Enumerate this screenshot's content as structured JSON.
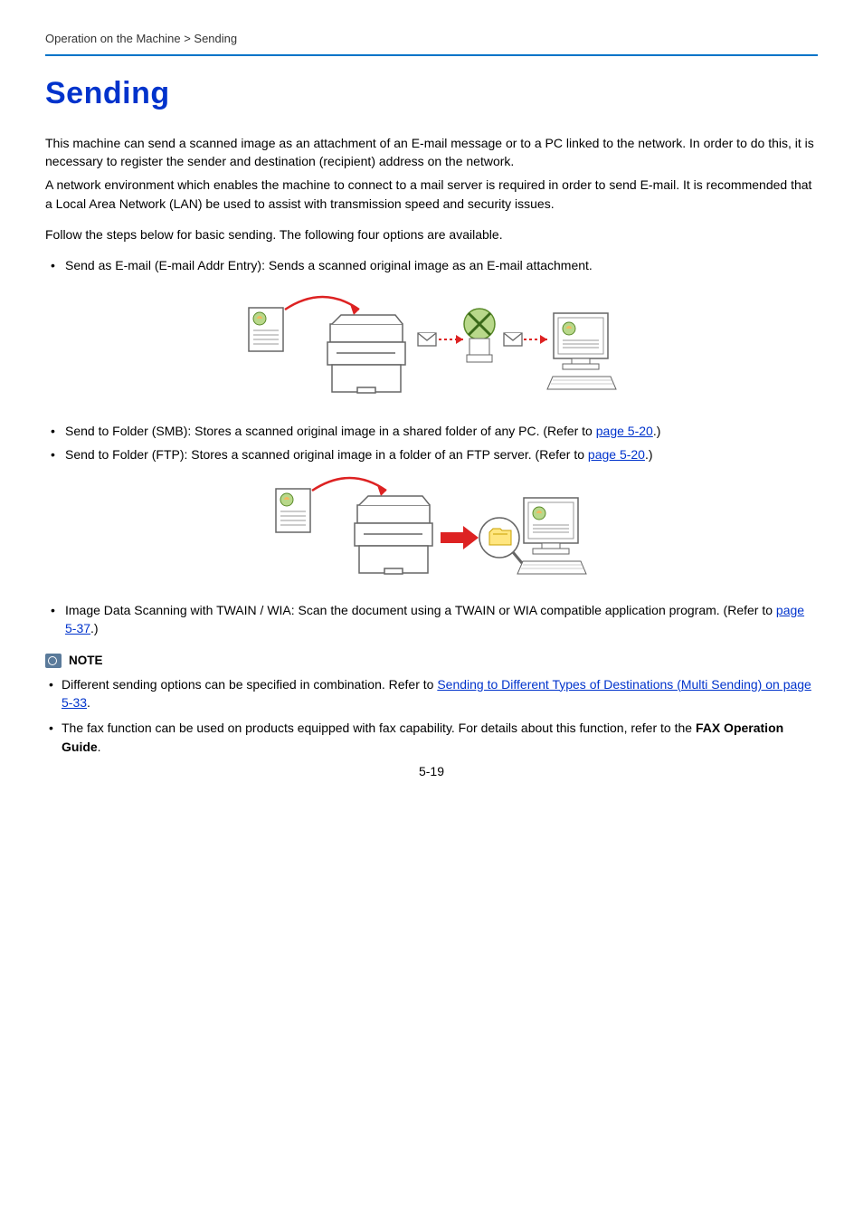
{
  "breadcrumb": "Operation on the Machine > Sending",
  "heading": "Sending",
  "intro1": "This machine can send a scanned image as an attachment of an E-mail message or to a PC linked to the network. In order to do this, it is necessary to register the sender and destination (recipient) address on the network.",
  "intro2": "A network environment which enables the machine to connect to a mail server is required in order to send E-mail. It is recommended that a Local Area Network (LAN) be used to assist with transmission speed and security issues.",
  "intro3": "Follow the steps below for basic sending. The following four options are available.",
  "bullets": {
    "email": "Send as E-mail (E-mail Addr Entry): Sends a scanned original image as an E-mail attachment.",
    "smb_a": "Send to Folder (SMB): Stores a scanned original image in a shared folder of any PC. (Refer to ",
    "smb_link": "page 5-20",
    "smb_b": ".)",
    "ftp_a": "Send to Folder (FTP): Stores a scanned original image in a folder of an FTP server. (Refer to ",
    "ftp_link": "page 5-20",
    "ftp_b": ".)",
    "twain_a": "Image Data Scanning with TWAIN / WIA: Scan the document using a TWAIN or WIA compatible application program. (Refer to ",
    "twain_link": "page 5-37",
    "twain_b": ".)"
  },
  "note": {
    "label": "NOTE",
    "item1_a": "Different sending options can be specified in combination. Refer to ",
    "item1_link": "Sending to Different Types of Destinations (Multi Sending) on page 5-33",
    "item1_b": ".",
    "item2_a": "The fax function can be used on products equipped with fax capability. For details about this function, refer to the ",
    "item2_bold": "FAX Operation Guide",
    "item2_b": "."
  },
  "pagenum": "5-19"
}
